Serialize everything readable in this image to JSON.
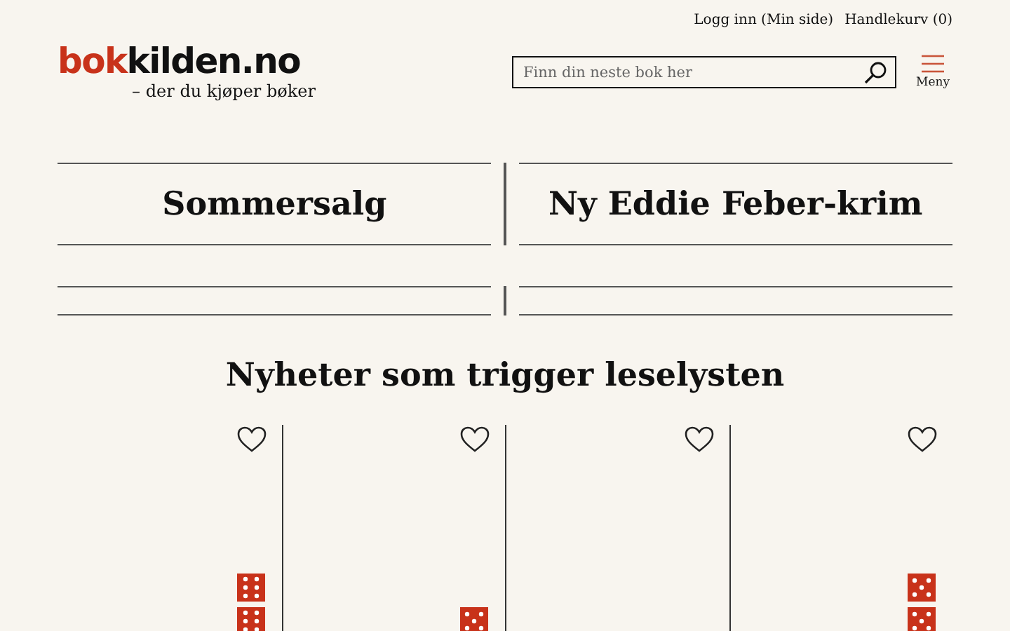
{
  "top_links": [
    "Logg inn (Min side)",
    "Handlekurv (0)"
  ],
  "logo": {
    "brand": "bok",
    "rest": "kilden.no",
    "tagline": "– der du kjøper bøker"
  },
  "search": {
    "placeholder": "Finn din neste bok her"
  },
  "menu": {
    "label": "Meny"
  },
  "banners": [
    {
      "title": "Sommersalg"
    },
    {
      "title": "Ny Eddie Feber-krim"
    }
  ],
  "heading": "Nyheter som trigger leselysten",
  "products": [
    {
      "favorite": false,
      "ratings": [
        {
          "kind": "six"
        },
        {
          "kind": "six"
        }
      ]
    },
    {
      "favorite": false,
      "ratings": [
        {
          "kind": "five"
        }
      ]
    },
    {
      "favorite": false
    },
    {
      "favorite": false,
      "ratings": [
        {
          "kind": "five"
        },
        {
          "kind": "five"
        }
      ]
    }
  ]
}
